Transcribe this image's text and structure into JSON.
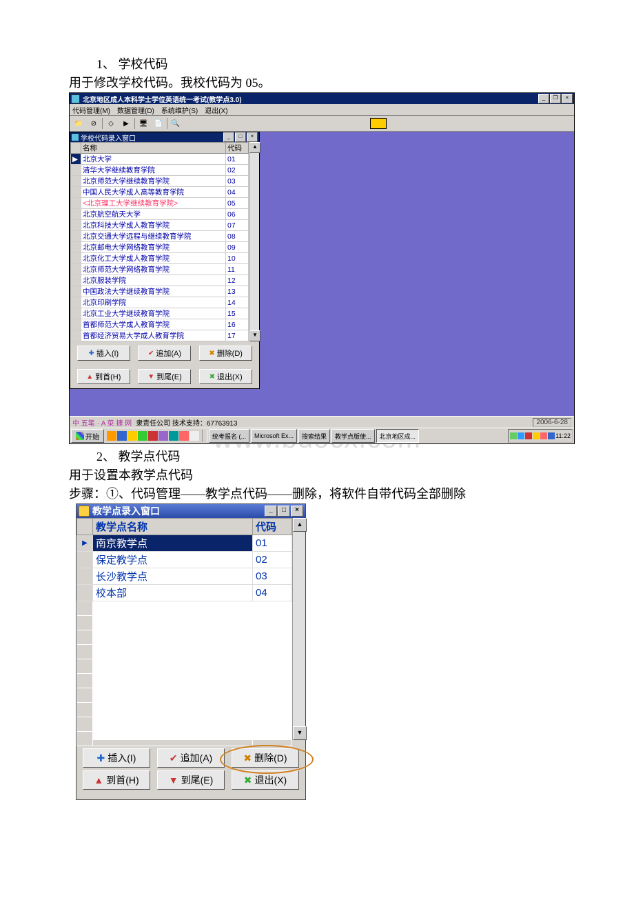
{
  "doc": {
    "section1_title": "1、 学校代码",
    "section1_line": "用于修改学校代码。我校代码为 05。",
    "section2_title": "2、 教学点代码",
    "section2_line1": "用于设置本教学点代码",
    "section2_line2": "步骤：①、代码管理——教学点代码——删除，将软件自带代码全部删除",
    "watermark": "www.bdocx.com"
  },
  "shot1": {
    "app_title": "北京地区成人本科学士学位英语统一考试(教学点3.0)",
    "menu": [
      "代码管理(M)",
      "数据管理(D)",
      "系统维护(S)",
      "退出(X)"
    ],
    "child_title": "学校代码录入窗口",
    "col_name": "名称",
    "col_code": "代码",
    "rows": [
      {
        "name": "北京大学",
        "code": "01",
        "sel": true
      },
      {
        "name": "清华大学继续教育学院",
        "code": "02"
      },
      {
        "name": "北京师范大学继续教育学院",
        "code": "03"
      },
      {
        "name": "中国人民大学成人高等教育学院",
        "code": "04"
      },
      {
        "name": "北京理工大学继续教育学院",
        "code": "05",
        "hl": true
      },
      {
        "name": "北京航空航天大学",
        "code": "06"
      },
      {
        "name": "北京科技大学成人教育学院",
        "code": "07"
      },
      {
        "name": "北京交通大学远程与继续教育学院",
        "code": "08"
      },
      {
        "name": "北京邮电大学网络教育学院",
        "code": "09"
      },
      {
        "name": "北京化工大学成人教育学院",
        "code": "10"
      },
      {
        "name": "北京师范大学网络教育学院",
        "code": "11"
      },
      {
        "name": "北京服装学院",
        "code": "12"
      },
      {
        "name": "中国政法大学继续教育学院",
        "code": "13"
      },
      {
        "name": "北京印刷学院",
        "code": "14"
      },
      {
        "name": "北京工业大学继续教育学院",
        "code": "15"
      },
      {
        "name": "首都师范大学成人教育学院",
        "code": "16"
      },
      {
        "name": "首都经济贸易大学成人教育学院",
        "code": "17"
      }
    ],
    "buttons": {
      "insert": "插入(I)",
      "append": "追加(A)",
      "delete": "删除(D)",
      "first": "到首(H)",
      "last": "到尾(E)",
      "exit": "退出(X)"
    },
    "status_left_parts": [
      "中",
      "五笔",
      "·",
      "A",
      "菜",
      "捷",
      "网"
    ],
    "status_text": "隶责任公司    技术支持：67763913",
    "status_date": "2006-6-28",
    "start": "开始",
    "tasks": [
      "统考报名 (...",
      "Microsoft Ex...",
      "搜索结果",
      "教学点版使...",
      "北京地区成..."
    ],
    "clock": "11:22"
  },
  "shot2": {
    "title": "教学点录入窗口",
    "col_name": "教学点名称",
    "col_code": "代码",
    "rows": [
      {
        "name": "南京教学点",
        "code": "01",
        "sel": true
      },
      {
        "name": "保定教学点",
        "code": "02"
      },
      {
        "name": "长沙教学点",
        "code": "03"
      },
      {
        "name": "校本部",
        "code": "04"
      }
    ],
    "buttons": {
      "insert": "插入(I)",
      "append": "追加(A)",
      "delete": "删除(D)",
      "first": "到首(H)",
      "last": "到尾(E)",
      "exit": "退出(X)"
    }
  }
}
